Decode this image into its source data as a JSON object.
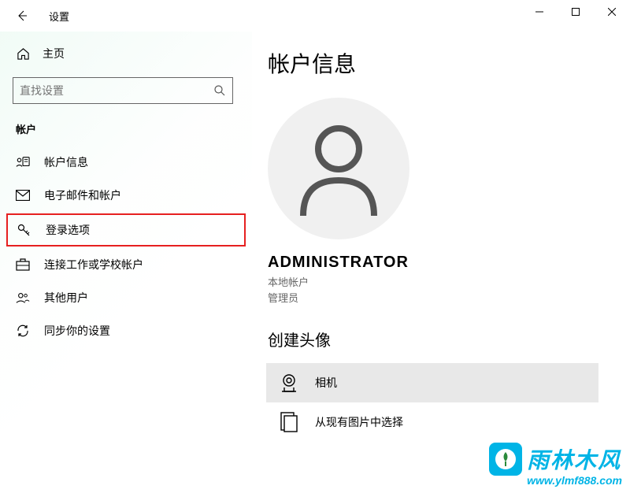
{
  "titlebar": {
    "title": "设置"
  },
  "sidebar": {
    "home": "主页",
    "search_placeholder": "直找设置",
    "section": "帐户",
    "items": [
      {
        "label": "帐户信息"
      },
      {
        "label": "电子邮件和帐户"
      },
      {
        "label": "登录选项"
      },
      {
        "label": "连接工作或学校帐户"
      },
      {
        "label": "其他用户"
      },
      {
        "label": "同步你的设置"
      }
    ]
  },
  "main": {
    "title": "帐户信息",
    "username": "ADMINISTRATOR",
    "account_type": "本地帐户",
    "role": "管理员",
    "create_avatar": "创建头像",
    "camera": "相机",
    "browse": "从现有图片中选择"
  },
  "watermark": {
    "text": "雨林木风",
    "url": "www.ylmf888.com"
  }
}
